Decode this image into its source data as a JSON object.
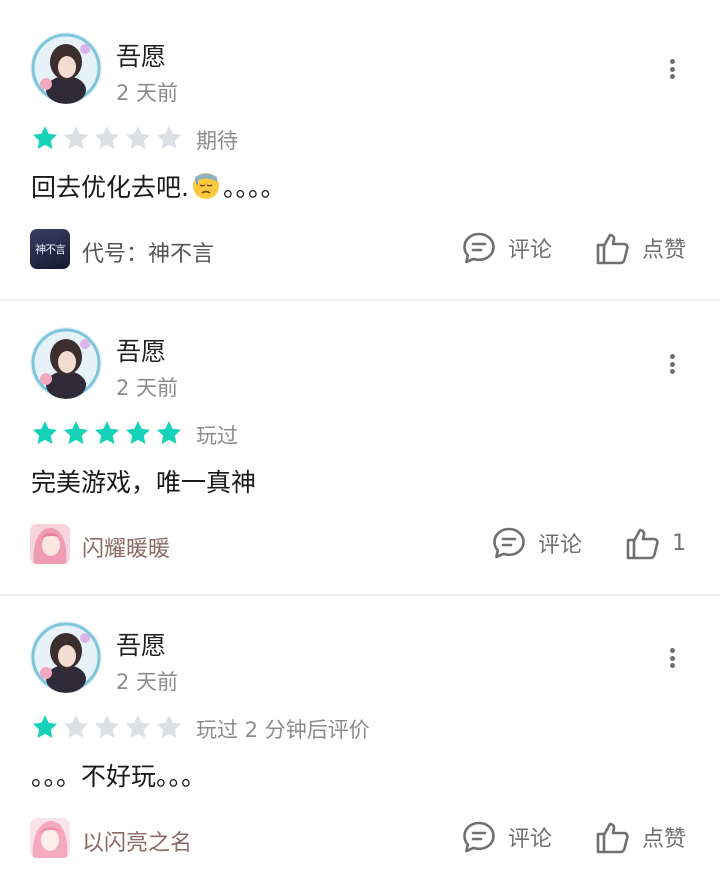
{
  "reviews": [
    {
      "username": "吾愿",
      "time": "2 天前",
      "rating": 1,
      "status": "期待",
      "content_before": "回去优化去吧.",
      "content_emoji": "downcast-sweat-emoji",
      "content_after": "。。。。",
      "game": {
        "name": "代号：神不言",
        "icon": "shen-bu-yan-game-icon",
        "icon_text": "神不言",
        "name_color": "#555555"
      },
      "comment_label": "评论",
      "like_label": "点赞"
    },
    {
      "username": "吾愿",
      "time": "2 天前",
      "rating": 5,
      "status": "玩过",
      "content_before": "完美游戏，唯一真神",
      "content_emoji": "",
      "content_after": "",
      "game": {
        "name": "闪耀暖暖",
        "icon": "shining-nikki-game-icon",
        "icon_text": "",
        "name_color": "#8a6a64"
      },
      "comment_label": "评论",
      "like_label": "1"
    },
    {
      "username": "吾愿",
      "time": "2 天前",
      "rating": 1,
      "status": "玩过 2 分钟后评价",
      "content_before": "。。。不好玩。。。",
      "content_emoji": "",
      "content_after": "",
      "game": {
        "name": "以闪亮之名",
        "icon": "in-the-name-of-shine-game-icon",
        "icon_text": "",
        "name_color": "#8a6a64"
      },
      "comment_label": "评论",
      "like_label": "点赞"
    }
  ],
  "colors": {
    "star_active": "#15d2b8",
    "star_inactive": "#dcdfe4",
    "text_muted": "#8c8c8c",
    "divider": "#efefef"
  },
  "icons": {
    "more": "more-vertical-icon",
    "comment": "comment-bubble-icon",
    "like": "thumbs-up-icon",
    "avatar": "anime-girl-avatar"
  }
}
